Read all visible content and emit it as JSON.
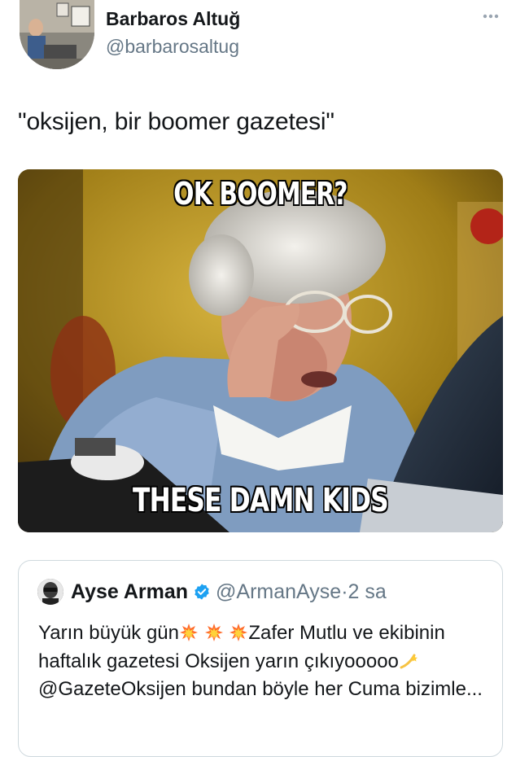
{
  "tweet": {
    "author_name": "Barbaros Altuğ",
    "author_handle": "@barbarosaltug",
    "text": "\"oksijen, bir boomer gazetesi\"",
    "more_icon": "more-dots-icon",
    "media": {
      "caption_top": "OK BOOMER?",
      "caption_bottom": "THESE DAMN KIDS"
    }
  },
  "quoted_tweet": {
    "author_name": "Ayse Arman",
    "verified_icon": "verified-badge-icon",
    "author_handle": "@ArmanAyse",
    "separator": "·",
    "time": "2 sa",
    "text_part1": "Yarın büyük gün",
    "text_part2": "Zafer Mutlu ve ekibinin  haftalık gazetesi Oksijen yarın çıkıyooooo",
    "mention": "@GazeteOksijen",
    "text_part3": " bundan böyle her Cuma bizimle...",
    "emoji_icons": [
      "collision-icon",
      "collision-icon",
      "collision-icon",
      "dizzy-icon"
    ]
  },
  "colors": {
    "text_primary": "#14171a",
    "text_secondary": "#657786",
    "verified": "#1da1f2",
    "border": "#cfd9de"
  }
}
